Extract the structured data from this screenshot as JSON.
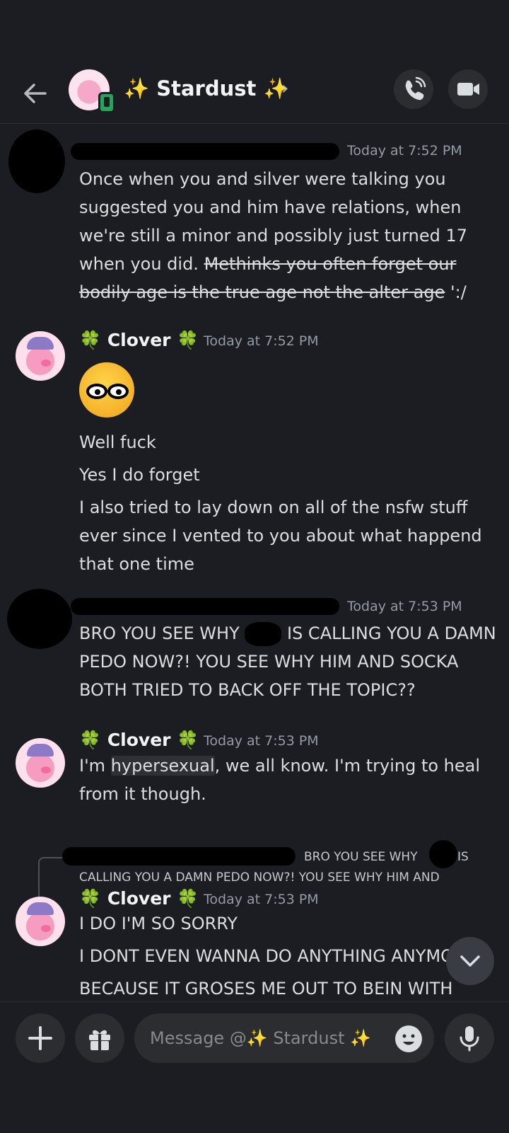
{
  "header": {
    "title": "✨ Stardust ✨",
    "chevron": "›"
  },
  "messages": [
    {
      "timestamp": "Today at 7:52 PM",
      "text_plain": "Once when you and silver were talking you suggested you and him have relations, when we're still a minor and possibly just turned 17 when you did. ",
      "text_strike": "Methinks you often forget our bodily age is the true age not the alter age",
      "text_tail": " ':/"
    },
    {
      "author": "🍀 Clover 🍀",
      "timestamp": "Today at 7:52 PM",
      "lines": [
        "Well fuck",
        "Yes I do forget",
        "I also tried to lay down on all of the nsfw stuff ever since I vented to you about what happend that one time"
      ]
    },
    {
      "timestamp": "Today at 7:53 PM",
      "text_a": "BRO YOU SEE WHY ",
      "text_b": " IS CALLING YOU A DAMN PEDO NOW?! YOU SEE WHY HIM AND SOCKA BOTH TRIED TO BACK OFF THE TOPIC??"
    },
    {
      "author": "🍀 Clover 🍀",
      "timestamp": "Today at 7:53 PM",
      "text_a": "I'm ",
      "text_hl": "hypersexual",
      "text_b": ", we all know. I'm trying to heal from it though."
    },
    {
      "reply_a": "BRO YOU SEE WHY",
      "reply_b": "IS",
      "reply_line2": "CALLING YOU A DAMN PEDO NOW?! YOU SEE WHY HIM AND",
      "author": "🍀 Clover 🍀",
      "timestamp": "Today at 7:53 PM",
      "line1": "I DO I'M SO SORRY",
      "line2": "I DONT EVEN WANNA DO ANYTHING ANYMORE",
      "line3": "BECAUSE IT GROSES ME OUT TO BEIN WITH"
    }
  ],
  "composer": {
    "placeholder": "Message @✨ Stardust ✨"
  },
  "icons": {
    "back": "arrow-left-icon",
    "call": "phone-icon",
    "video": "video-camera-icon",
    "plus": "plus-icon",
    "gift": "gift-icon",
    "emoji": "emoji-face-icon",
    "mic": "microphone-icon",
    "scroll": "chevron-down-icon"
  }
}
